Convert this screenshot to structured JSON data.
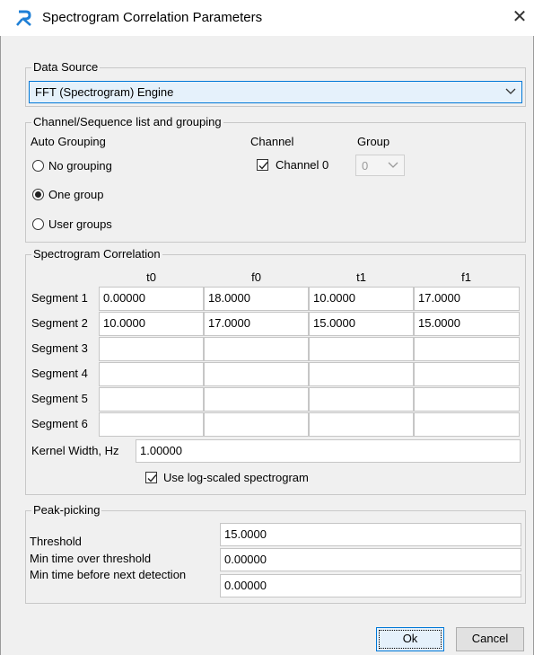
{
  "window": {
    "title": "Spectrogram Correlation Parameters"
  },
  "data_source": {
    "legend": "Data Source",
    "selected": "FFT (Spectrogram) Engine"
  },
  "channels": {
    "legend": "Channel/Sequence list and grouping",
    "auto_grouping_label": "Auto Grouping",
    "channel_header": "Channel",
    "group_header": "Group",
    "grouping_options": [
      {
        "label": "No grouping",
        "selected": false
      },
      {
        "label": "One group",
        "selected": true
      },
      {
        "label": "User groups",
        "selected": false
      }
    ],
    "channel_list": [
      {
        "label": "Channel 0",
        "checked": true,
        "group": "0"
      }
    ]
  },
  "correlation": {
    "legend": "Spectrogram Correlation",
    "columns": [
      "t0",
      "f0",
      "t1",
      "f1"
    ],
    "rows": [
      {
        "label": "Segment 1",
        "values": [
          "0.00000",
          "18.0000",
          "10.0000",
          "17.0000"
        ]
      },
      {
        "label": "Segment 2",
        "values": [
          "10.0000",
          "17.0000",
          "15.0000",
          "15.0000"
        ]
      },
      {
        "label": "Segment 3",
        "values": [
          "",
          "",
          "",
          ""
        ]
      },
      {
        "label": "Segment 4",
        "values": [
          "",
          "",
          "",
          ""
        ]
      },
      {
        "label": "Segment 5",
        "values": [
          "",
          "",
          "",
          ""
        ]
      },
      {
        "label": "Segment 6",
        "values": [
          "",
          "",
          "",
          ""
        ]
      }
    ],
    "kernel_label": "Kernel Width, Hz",
    "kernel_value": "1.00000",
    "log_scaled_label": "Use log-scaled spectrogram",
    "log_scaled_checked": true
  },
  "peak_picking": {
    "legend": "Peak-picking",
    "threshold_label": "Threshold",
    "threshold_value": "15.0000",
    "min_time_over_label": "Min time over threshold",
    "min_time_over_value": "0.00000",
    "min_time_before_label": "Min time before next detection",
    "min_time_before_value": "0.00000"
  },
  "buttons": {
    "ok": "Ok",
    "cancel": "Cancel"
  }
}
